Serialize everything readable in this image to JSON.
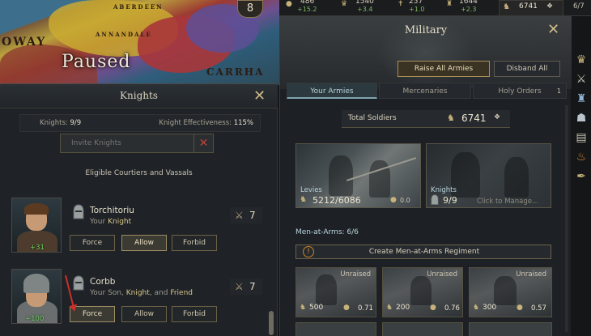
{
  "map": {
    "paused_label": "Paused",
    "badge_value": "8",
    "labels": [
      "OWAY",
      "ANNANDALE",
      "CARRHA",
      "ABERDEEN"
    ]
  },
  "topbar": {
    "resources": [
      {
        "icon": "gold-icon",
        "value": "486",
        "delta": "+15.2"
      },
      {
        "icon": "prestige-icon",
        "value": "1540",
        "delta": "+3.4"
      },
      {
        "icon": "piety-icon",
        "value": "257",
        "delta": "+1.0"
      },
      {
        "icon": "renown-icon",
        "value": "1644",
        "delta": "+2.3"
      }
    ],
    "soldiers_value": "6741",
    "fraction": "6/7"
  },
  "knights": {
    "title": "Knights",
    "count_label": "Knights:",
    "count_value": "9/9",
    "effectiveness_label": "Knight Effectiveness:",
    "effectiveness_value": "115%",
    "invite_placeholder": "Invite Knights",
    "eligible_label": "Eligible Courtiers and Vassals",
    "rows": [
      {
        "name": "Torchitoriu",
        "relation_prefix": "Your",
        "relation_highlight": "Knight",
        "relation_suffix": "",
        "skill": "+31",
        "prowess": "7",
        "buttons": {
          "force": "Force",
          "allow": "Allow",
          "forbid": "Forbid"
        },
        "selected": "allow"
      },
      {
        "name": "Corbb",
        "relation_prefix": "Your Son,",
        "relation_highlight": "Knight",
        "relation_suffix": ", and",
        "relation_highlight2": "Friend",
        "skill": "+100",
        "prowess": "7",
        "buttons": {
          "force": "Force",
          "allow": "Allow",
          "forbid": "Forbid"
        },
        "selected": "force"
      }
    ]
  },
  "military": {
    "title": "Military",
    "raise_all": "Raise All Armies",
    "disband_all": "Disband All",
    "tabs": [
      {
        "label": "Your Armies",
        "active": true
      },
      {
        "label": "Mercenaries",
        "active": false
      },
      {
        "label": "Holy Orders",
        "active": false,
        "count": "1"
      }
    ],
    "total_label": "Total Soldiers",
    "total_value": "6741",
    "levies": {
      "label": "Levies",
      "value": "5212/6086",
      "extra": "0.0"
    },
    "knights_card": {
      "label": "Knights",
      "value": "9/9",
      "hint": "Click to Manage..."
    },
    "maa_label": "Men-at-Arms: 6/6",
    "create_regiment": "Create Men-at-Arms Regiment",
    "units": [
      {
        "status": "Unraised",
        "count": "500",
        "strength": "0.71"
      },
      {
        "status": "Unraised",
        "count": "200",
        "strength": "0.76"
      },
      {
        "status": "Unraised",
        "count": "300",
        "strength": "0.57"
      }
    ]
  },
  "colors": {
    "accent": "#c8b27b",
    "panel": "#1f2327",
    "tab_active": "#b7d1d8",
    "positive": "#6fd15f",
    "danger": "#c0423b"
  }
}
